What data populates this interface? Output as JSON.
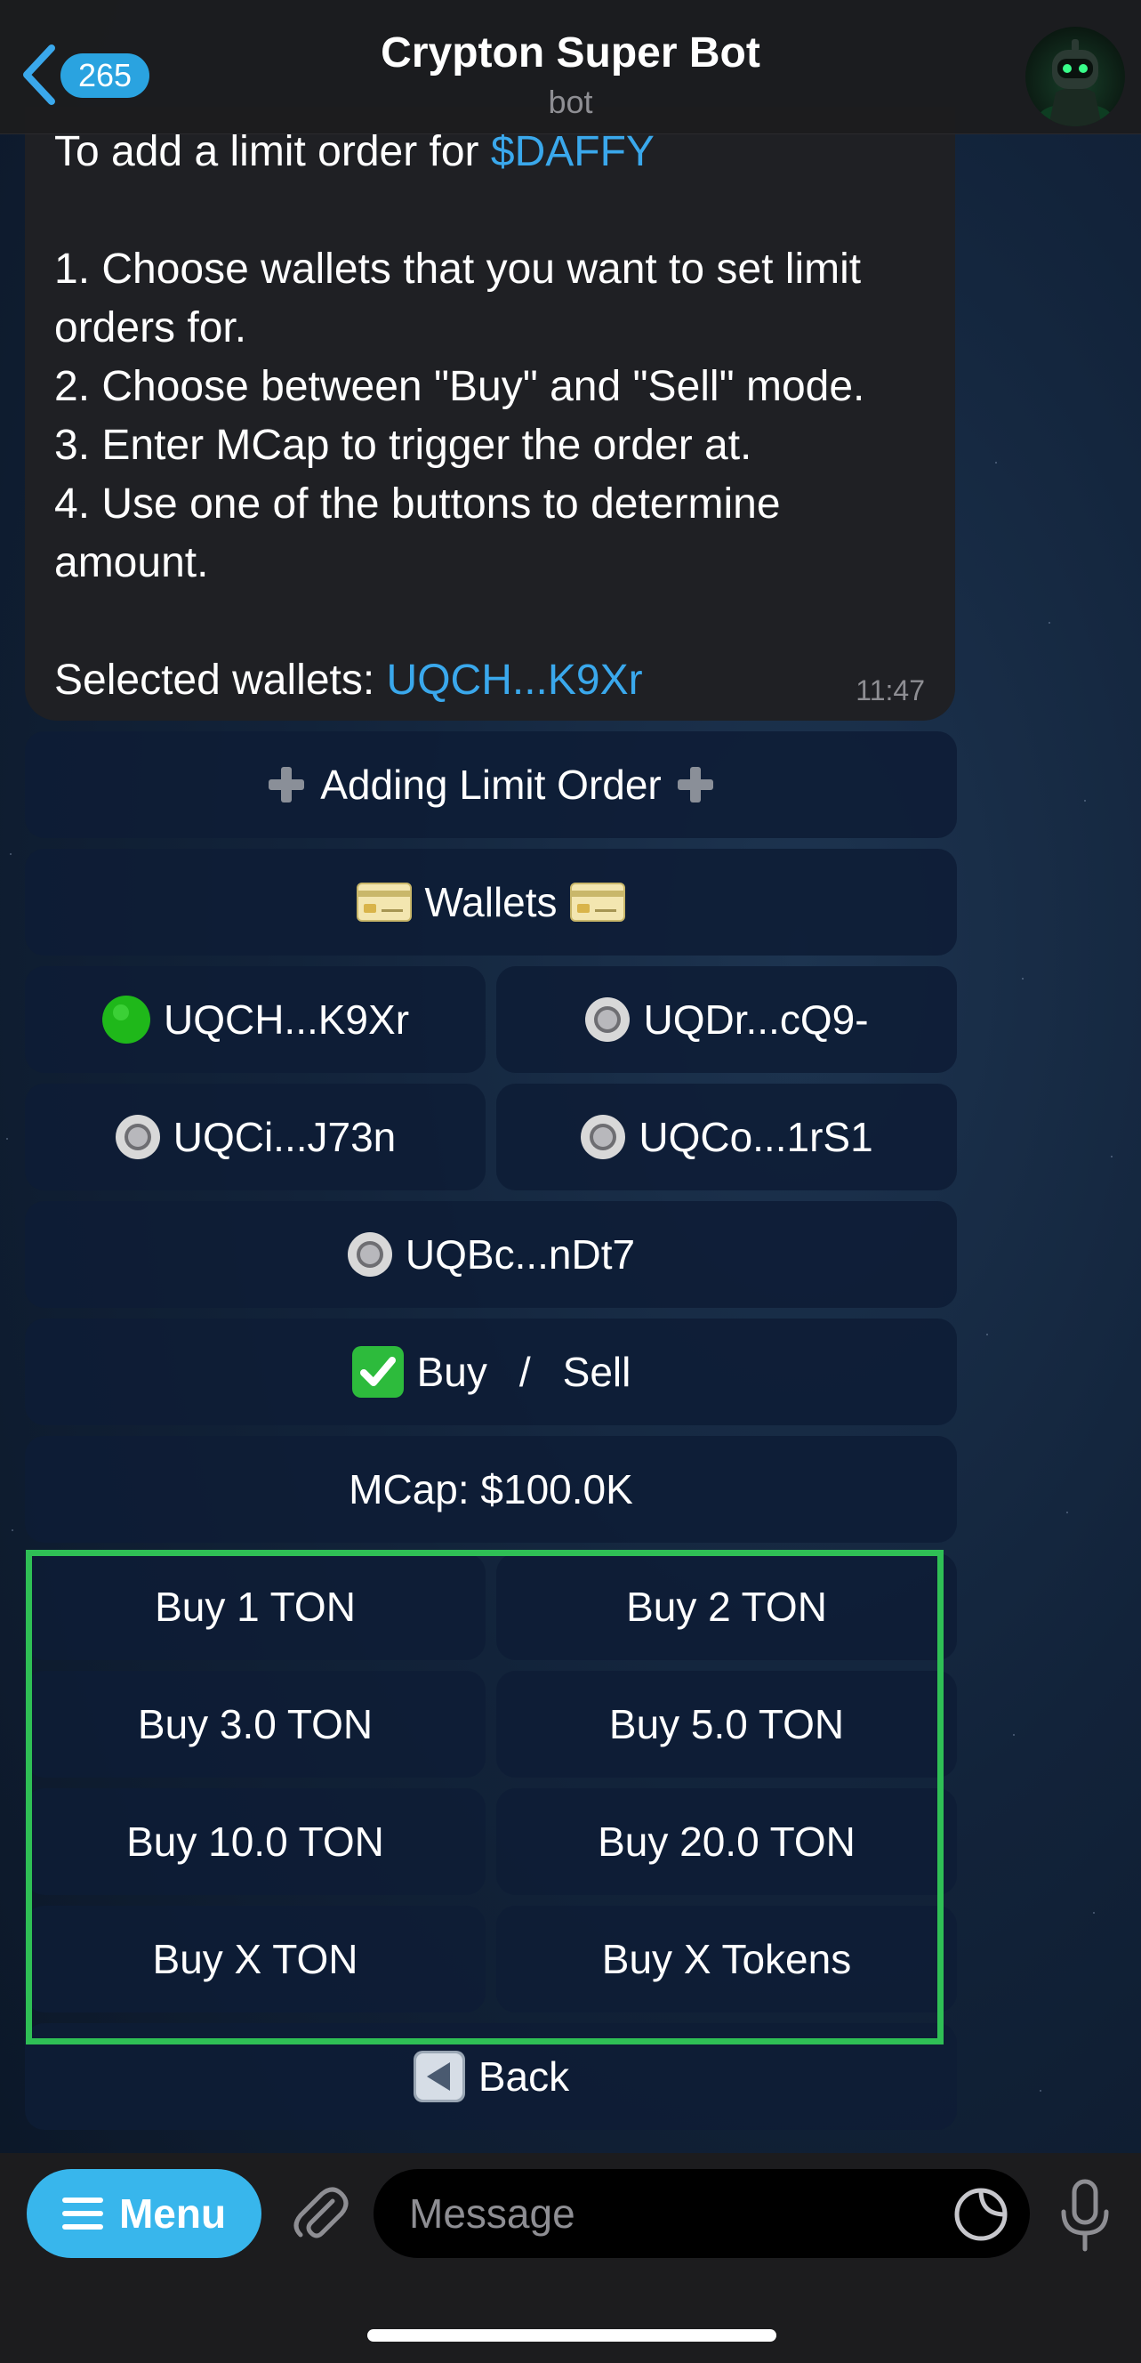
{
  "header": {
    "back_badge": "265",
    "title": "Crypton Super Bot",
    "subtitle": "bot"
  },
  "message": {
    "line1_prefix": "To add a limit order for ",
    "token_link": "$DAFFY",
    "steps": [
      "1. Choose wallets that you want to set limit",
      "orders for.",
      "2. Choose between \"Buy\" and \"Sell\" mode.",
      "3. Enter MCap to trigger the order at.",
      "4. Use one of the buttons to determine",
      "amount."
    ],
    "selected_prefix": "Selected wallets: ",
    "selected_wallet": "UQCH...K9Xr",
    "time": "11:47"
  },
  "keyboard": {
    "adding_label": "Adding Limit Order",
    "wallets_label": "Wallets",
    "wallets": [
      {
        "label": "UQCH...K9Xr",
        "selected": true
      },
      {
        "label": "UQDr...cQ9-",
        "selected": false
      },
      {
        "label": "UQCi...J73n",
        "selected": false
      },
      {
        "label": "UQCo...1rS1",
        "selected": false
      },
      {
        "label": "UQBc...nDt7",
        "selected": false
      }
    ],
    "mode_buy": "Buy",
    "mode_sep": "/",
    "mode_sell": "Sell",
    "mcap_label": "MCap: $100.0K",
    "amounts": [
      "Buy 1 TON",
      "Buy 2 TON",
      "Buy 3.0 TON",
      "Buy 5.0 TON",
      "Buy 10.0 TON",
      "Buy 20.0 TON",
      "Buy X TON",
      "Buy X Tokens"
    ],
    "back_label": "Back"
  },
  "input_bar": {
    "menu_label": "Menu",
    "message_placeholder": "Message"
  },
  "colors": {
    "accent": "#38b6ec",
    "link": "#3aa8ec",
    "highlight": "#2fbf55",
    "selected_dot": "#22c21e"
  }
}
